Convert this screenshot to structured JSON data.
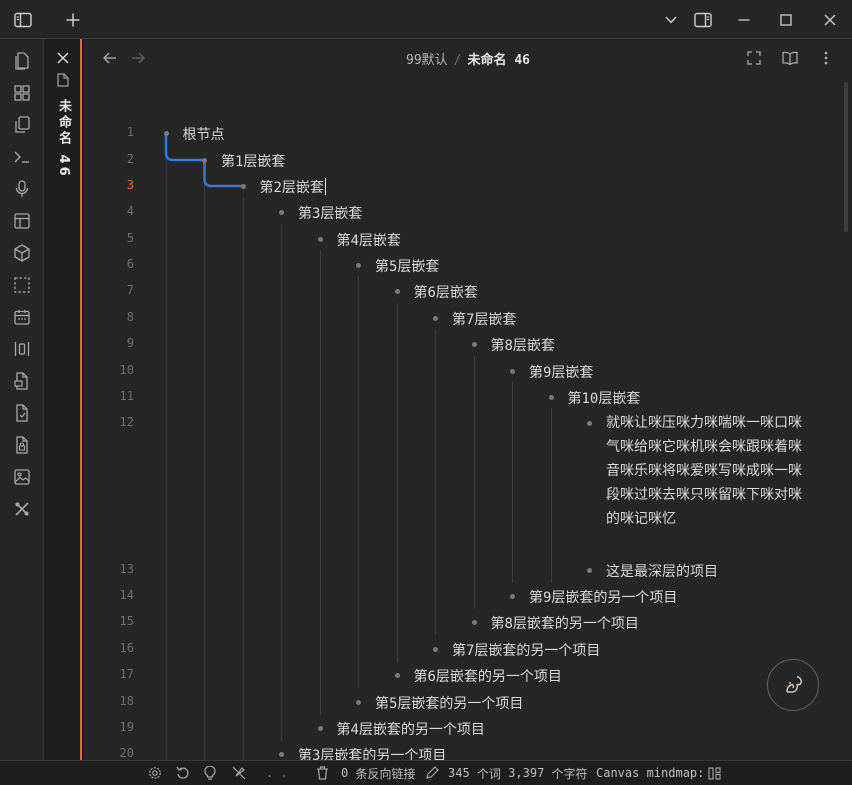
{
  "tab": {
    "title": "未命名 46"
  },
  "breadcrumb": {
    "folder": "99默认",
    "separator": "/",
    "current": "未命名 46"
  },
  "outline": [
    {
      "line": "1",
      "text": "根节点",
      "level": 0
    },
    {
      "line": "2",
      "text": "第1层嵌套",
      "level": 1
    },
    {
      "line": "3",
      "text": "第2层嵌套",
      "level": 2,
      "active": true
    },
    {
      "line": "4",
      "text": "第3层嵌套",
      "level": 3
    },
    {
      "line": "5",
      "text": "第4层嵌套",
      "level": 4
    },
    {
      "line": "6",
      "text": "第5层嵌套",
      "level": 5
    },
    {
      "line": "7",
      "text": "第6层嵌套",
      "level": 6
    },
    {
      "line": "8",
      "text": "第7层嵌套",
      "level": 7
    },
    {
      "line": "9",
      "text": "第8层嵌套",
      "level": 8
    },
    {
      "line": "10",
      "text": "第9层嵌套",
      "level": 9
    },
    {
      "line": "11",
      "text": "第10层嵌套",
      "level": 10
    },
    {
      "line": "12",
      "text": "就咪让咪压咪力咪喘咪一咪口咪气咪给咪它咪机咪会咪跟咪着咪音咪乐咪将咪爱咪写咪成咪一咪段咪过咪去咪只咪留咪下咪对咪的咪记咪忆",
      "level": 11
    },
    {
      "line": "13",
      "text": "这是最深层的项目",
      "level": 11
    },
    {
      "line": "14",
      "text": "第9层嵌套的另一个项目",
      "level": 9
    },
    {
      "line": "15",
      "text": "第8层嵌套的另一个项目",
      "level": 8
    },
    {
      "line": "16",
      "text": "第7层嵌套的另一个项目",
      "level": 7
    },
    {
      "line": "17",
      "text": "第6层嵌套的另一个项目",
      "level": 6
    },
    {
      "line": "18",
      "text": "第5层嵌套的另一个项目",
      "level": 5
    },
    {
      "line": "19",
      "text": "第4层嵌套的另一个项目",
      "level": 4
    },
    {
      "line": "20",
      "text": "第3层嵌套的另一个项目",
      "level": 3
    }
  ],
  "status": {
    "backlinks_count": "0",
    "backlinks_label": "条反向链接",
    "words_count": "345",
    "words_label": "个词",
    "chars_count": "3,397",
    "chars_label": "个字符",
    "plugin_label": "Canvas mindmap:",
    "dots": ". ."
  },
  "colors": {
    "accent": "#d9741d",
    "connector": "#2f7bd6"
  }
}
